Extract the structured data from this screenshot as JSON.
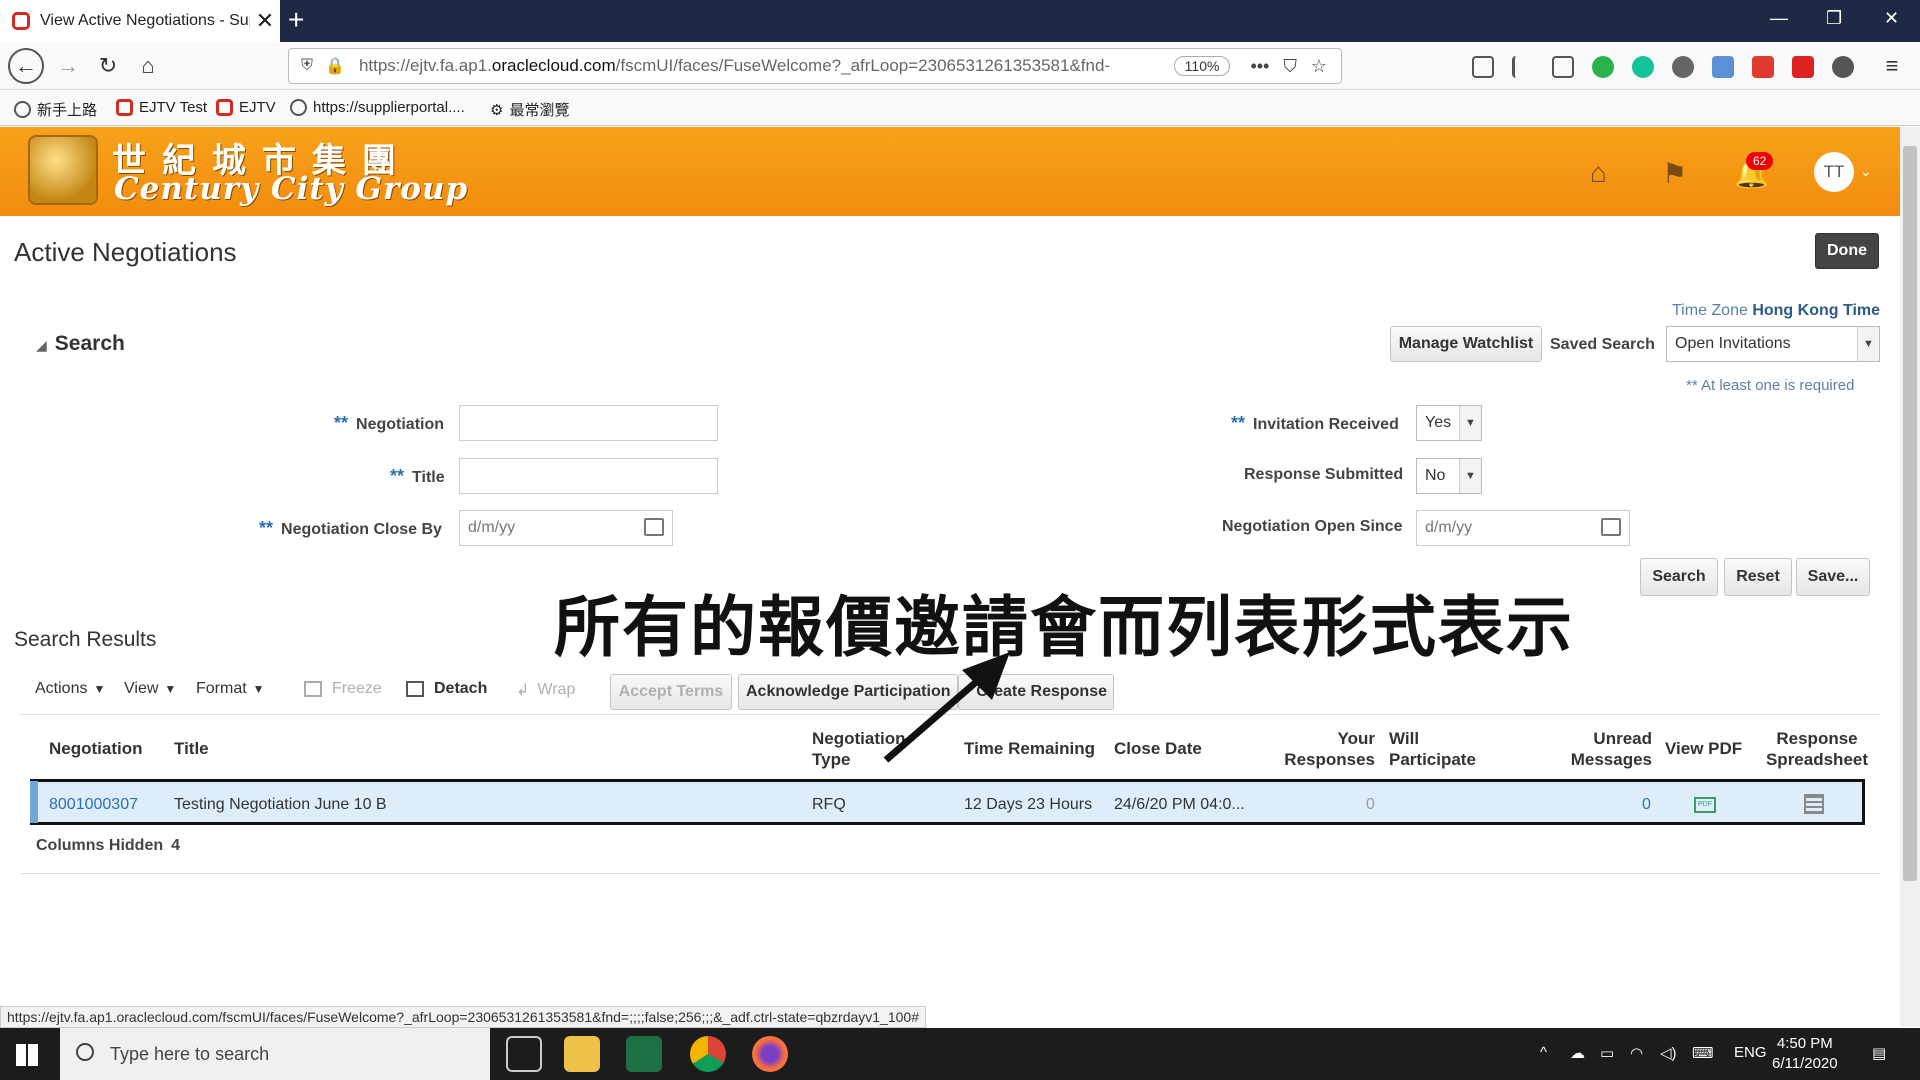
{
  "browser": {
    "tab_title": "View Active Negotiations - Sup",
    "url_prefix": "https://ejtv.fa.ap1.",
    "url_host": "oraclecloud.com",
    "url_rest": "/fscmUI/faces/FuseWelcome?_afrLoop=2306531261353581&fnd-",
    "zoom": "110%",
    "bookmarks": [
      "新手上路",
      "EJTV Test",
      "EJTV",
      "https://supplierportal....",
      "最常瀏覽"
    ]
  },
  "header": {
    "logo_zh": "世紀城市集團",
    "logo_en": "Century City Group",
    "notification_count": "62",
    "avatar_initials": "TT"
  },
  "page": {
    "title": "Active Negotiations",
    "done_label": "Done",
    "time_zone_label": "Time Zone",
    "time_zone_value": "Hong Kong Time"
  },
  "search": {
    "header": "Search",
    "manage_watchlist": "Manage Watchlist",
    "saved_search_label": "Saved Search",
    "saved_search_value": "Open Invitations",
    "required_hint": "** At least one is required",
    "req_marker": "**",
    "negotiation_label": "Negotiation",
    "title_label": "Title",
    "close_by_label": "Negotiation Close By",
    "close_by_placeholder": "d/m/yy",
    "invitation_label": "Invitation Received",
    "invitation_value": "Yes",
    "response_label": "Response Submitted",
    "response_value": "No",
    "open_since_label": "Negotiation Open Since",
    "open_since_placeholder": "d/m/yy",
    "search_btn": "Search",
    "reset_btn": "Reset",
    "save_btn": "Save..."
  },
  "results": {
    "title": "Search Results",
    "actions": "Actions",
    "view": "View",
    "format": "Format",
    "freeze": "Freeze",
    "detach": "Detach",
    "wrap": "Wrap",
    "accept_terms": "Accept Terms",
    "acknowledge": "Acknowledge Participation",
    "create_response": "Create Response",
    "columns": {
      "negotiation": "Negotiation",
      "title": "Title",
      "type_1": "Negotiation",
      "type_2": "Type",
      "time_remaining": "Time Remaining",
      "close_date": "Close Date",
      "your_1": "Your",
      "your_2": "Responses",
      "will_1": "Will",
      "will_2": "Participate",
      "unread_1": "Unread",
      "unread_2": "Messages",
      "view_pdf": "View PDF",
      "resp_1": "Response",
      "resp_2": "Spreadsheet"
    },
    "rows": [
      {
        "negotiation": "8001000307",
        "title": "Testing Negotiation June 10 B",
        "type": "RFQ",
        "time_remaining": "12 Days 23 Hours",
        "close_date": "24/6/20 PM 04:0...",
        "your_responses": "0",
        "unread": "0"
      }
    ],
    "columns_hidden_label": "Columns Hidden",
    "columns_hidden_value": "4"
  },
  "overlay": {
    "caption": "所有的報價邀請會而列表形式表示"
  },
  "status_url": "https://ejtv.fa.ap1.oraclecloud.com/fscmUI/faces/FuseWelcome?_afrLoop=2306531261353581&fnd=;;;;false;256;;;&_adf.ctrl-state=qbzrdayv1_100#",
  "taskbar": {
    "search_placeholder": "Type here to search",
    "lang": "ENG",
    "time": "4:50 PM",
    "date": "6/11/2020"
  },
  "colors": {
    "header_orange": "#f28c0f",
    "link_blue": "#2e6fb0",
    "row_highlight": "#ddeefa"
  }
}
